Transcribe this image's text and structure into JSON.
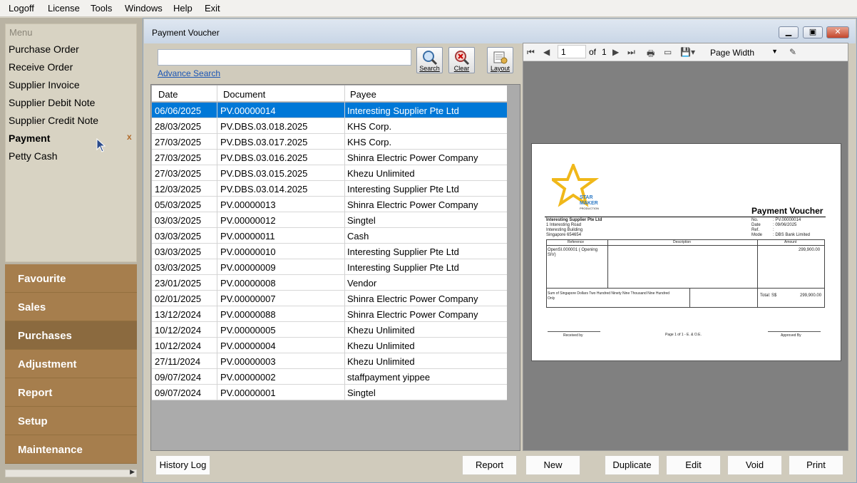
{
  "menubar": [
    "Logoff",
    "License",
    "Tools",
    "Windows",
    "Help",
    "Exit"
  ],
  "menu": {
    "header": "Menu",
    "items": [
      "Purchase Order",
      "Receive Order",
      "Supplier Invoice",
      "Supplier Debit Note",
      "Supplier Credit Note",
      "Payment",
      "Petty Cash"
    ],
    "close_symbol": "x"
  },
  "nav_sections": [
    "Favourite",
    "Sales",
    "Purchases",
    "Adjustment",
    "Report",
    "Setup",
    "Maintenance"
  ],
  "window": {
    "title": "Payment Voucher"
  },
  "search": {
    "value": "",
    "advanced_link": "Advance Search",
    "buttons": {
      "search": "Search",
      "clear": "Clear",
      "layout": "Layout"
    }
  },
  "grid": {
    "columns": [
      "Date",
      "Document",
      "Payee"
    ],
    "rows": [
      [
        "06/06/2025",
        "PV.00000014",
        "Interesting Supplier Pte Ltd"
      ],
      [
        "28/03/2025",
        "PV.DBS.03.018.2025",
        "KHS Corp."
      ],
      [
        "27/03/2025",
        "PV.DBS.03.017.2025",
        "KHS Corp."
      ],
      [
        "27/03/2025",
        "PV.DBS.03.016.2025",
        "Shinra Electric Power Company"
      ],
      [
        "27/03/2025",
        "PV.DBS.03.015.2025",
        "Khezu Unlimited"
      ],
      [
        "12/03/2025",
        "PV.DBS.03.014.2025",
        "Interesting Supplier Pte Ltd"
      ],
      [
        "05/03/2025",
        "PV.00000013",
        "Shinra Electric Power Company"
      ],
      [
        "03/03/2025",
        "PV.00000012",
        "Singtel"
      ],
      [
        "03/03/2025",
        "PV.00000011",
        "Cash"
      ],
      [
        "03/03/2025",
        "PV.00000010",
        "Interesting Supplier Pte Ltd"
      ],
      [
        "03/03/2025",
        "PV.00000009",
        "Interesting Supplier Pte Ltd"
      ],
      [
        "23/01/2025",
        "PV.00000008",
        "Vendor"
      ],
      [
        "02/01/2025",
        "PV.00000007",
        "Shinra Electric Power Company"
      ],
      [
        "13/12/2024",
        "PV.00000088",
        "Shinra Electric Power Company"
      ],
      [
        "10/12/2024",
        "PV.00000005",
        "Khezu Unlimited"
      ],
      [
        "10/12/2024",
        "PV.00000004",
        "Khezu Unlimited"
      ],
      [
        "27/11/2024",
        "PV.00000003",
        "Khezu Unlimited"
      ],
      [
        "09/07/2024",
        "PV.00000002",
        "staffpayment yippee"
      ],
      [
        "09/07/2024",
        "PV.00000001",
        "Singtel"
      ]
    ]
  },
  "preview": {
    "page_current": "1",
    "page_of": "of",
    "page_total": "1",
    "zoom": "Page Width",
    "document": {
      "logo_line1": "STAR",
      "logo_line2": "MAKER",
      "logo_line3": "PRODUCTION",
      "heading": "Payment Voucher",
      "payee_lines": [
        "Interesting Supplier Pte Ltd",
        "1 Interesting Road",
        "Interesting Building",
        "Singapore 654654"
      ],
      "meta_labels": [
        "No.",
        "Date",
        "Ref.",
        "Mode"
      ],
      "meta_values": [
        ": PV.00000014",
        ": 09/06/2025",
        ":",
        ": DBS Bank Limited"
      ],
      "table_headers": [
        "Reference",
        "Description",
        "Amount"
      ],
      "line_ref": "OpenSI.000001 ( Opening SIV)",
      "line_amount": "299,900.00",
      "amount_words": "Sum of Singapore Dollars Two Hundred Ninety Nine Thousand Nine Hundred Only",
      "total_label": "Total: S$",
      "total_value": "299,900.00",
      "received_by": "Received by",
      "page_info": "Page 1 of 1 - E. & O.E.",
      "approved_by": "Approved By"
    }
  },
  "buttons": {
    "history_log": "History Log",
    "report": "Report",
    "new": "New",
    "duplicate": "Duplicate",
    "edit": "Edit",
    "void": "Void",
    "print": "Print"
  },
  "colors": {
    "selection": "#0078d7",
    "nav": "#a67e4d",
    "nav_active": "#8b6a3f",
    "link": "#1a55b5"
  }
}
